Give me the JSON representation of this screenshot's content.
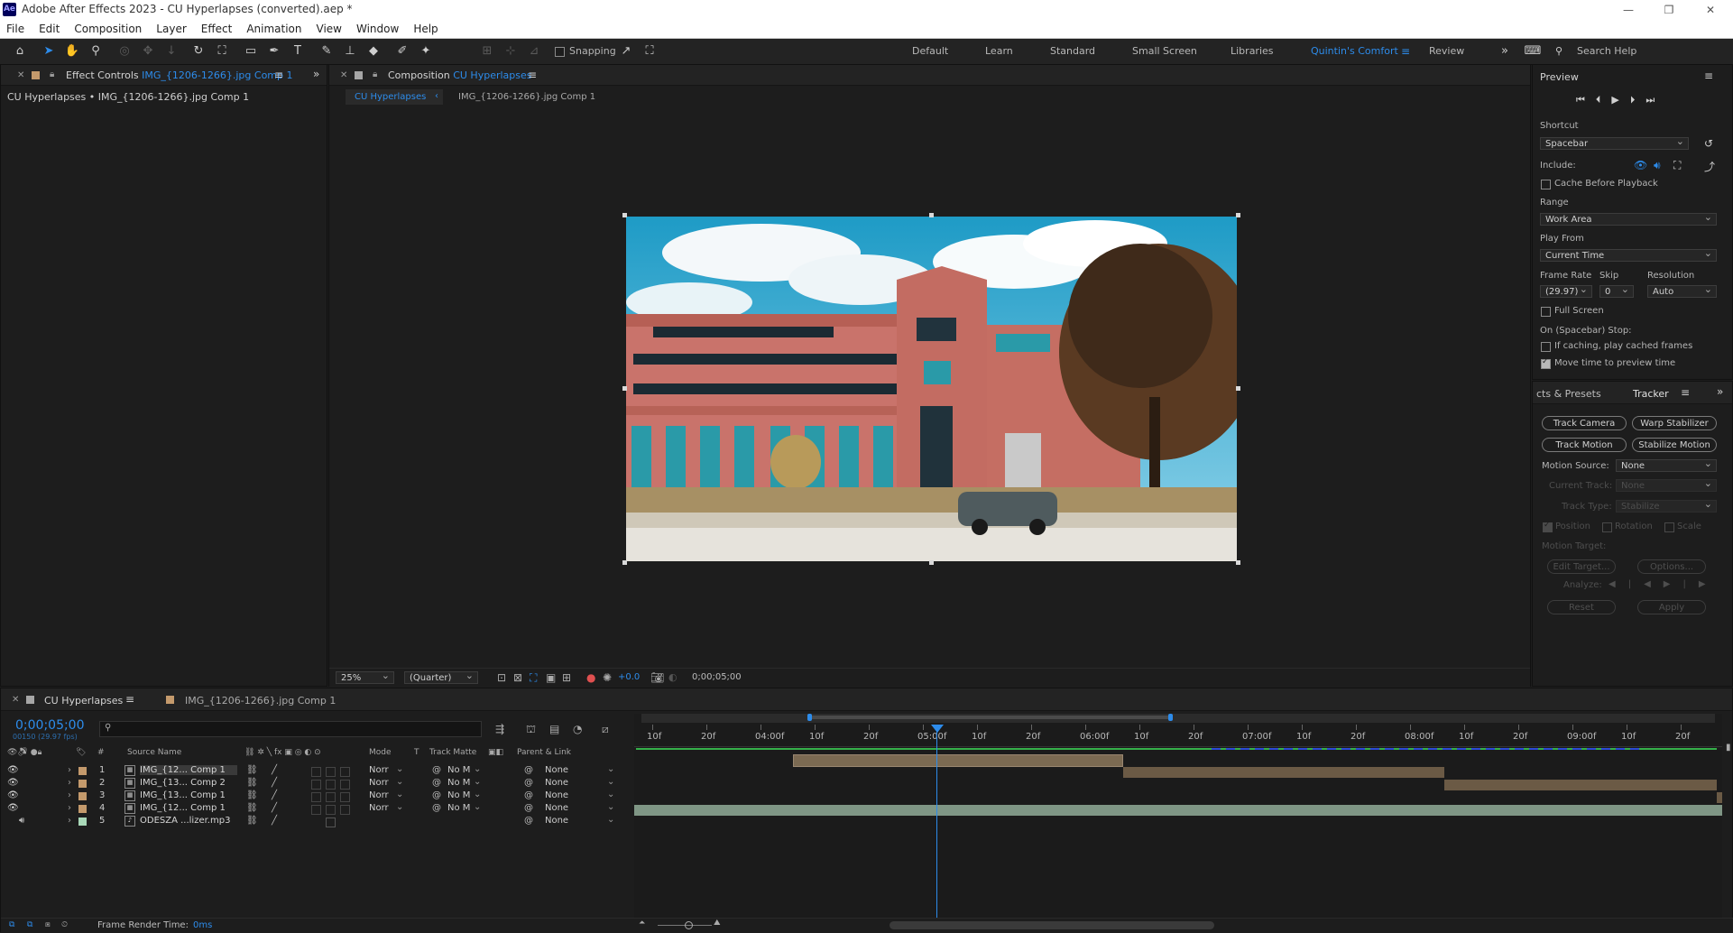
{
  "app": {
    "title": "Adobe After Effects 2023 - CU Hyperlapses (converted).aep *",
    "icon": "Ae",
    "window_controls": [
      "—",
      "❐",
      "✕"
    ]
  },
  "menu": [
    "File",
    "Edit",
    "Composition",
    "Layer",
    "Effect",
    "Animation",
    "View",
    "Window",
    "Help"
  ],
  "toolbar": {
    "snapping_label": "Snapping",
    "workspaces": [
      "Default",
      "Learn",
      "Standard",
      "Small Screen",
      "Libraries",
      "Quintin's Comfort",
      "Review"
    ],
    "active_workspace": "Quintin's Comfort",
    "search_placeholder": "Search Help"
  },
  "effect_controls": {
    "tab_prefix": "Effect Controls",
    "tab_target": "IMG_{1206-1266}.jpg Comp 1",
    "subheader": "CU Hyperlapses • IMG_{1206-1266}.jpg Comp 1"
  },
  "composition": {
    "tab_prefix": "Composition",
    "tab_target": "CU Hyperlapses",
    "flow_current": "CU Hyperlapses",
    "flow_next": "IMG_{1206-1266}.jpg Comp 1",
    "zoom": "25%",
    "resolution": "(Quarter)",
    "exposure": "+0.0",
    "timecode": "0;00;05;00"
  },
  "preview": {
    "title": "Preview",
    "shortcut_label": "Shortcut",
    "shortcut_value": "Spacebar",
    "include_label": "Include:",
    "cache_before_playback": "Cache Before Playback",
    "range_label": "Range",
    "range_value": "Work Area",
    "play_from_label": "Play From",
    "play_from_value": "Current Time",
    "frame_rate_label": "Frame Rate",
    "skip_label": "Skip",
    "resolution_label": "Resolution",
    "frame_rate_value": "(29.97)",
    "skip_value": "0",
    "resolution_value": "Auto",
    "full_screen": "Full Screen",
    "on_stop_label": "On (Spacebar) Stop:",
    "if_caching": "If caching, play cached frames",
    "move_time": "Move time to preview time"
  },
  "tracker": {
    "effects_tab": "cts & Presets",
    "tracker_tab": "Tracker",
    "track_camera": "Track Camera",
    "warp_stabilizer": "Warp Stabilizer",
    "track_motion": "Track Motion",
    "stabilize_motion": "Stabilize Motion",
    "motion_source_label": "Motion Source:",
    "motion_source_value": "None",
    "current_track_label": "Current Track:",
    "current_track_value": "None",
    "track_type_label": "Track Type:",
    "track_type_value": "Stabilize",
    "position": "Position",
    "rotation": "Rotation",
    "scale": "Scale",
    "motion_target_label": "Motion Target:",
    "edit_target": "Edit Target...",
    "options": "Options...",
    "analyze_label": "Analyze:",
    "reset": "Reset",
    "apply": "Apply"
  },
  "timeline": {
    "tab_active": "CU Hyperlapses",
    "tab_other": "IMG_{1206-1266}.jpg Comp 1",
    "current_time": "0;00;05;00",
    "frame_info": "00150 (29.97 fps)",
    "col_num": "#",
    "col_source": "Source Name",
    "col_mode": "Mode",
    "col_t": "T",
    "col_trackmatte": "Track Matte",
    "col_parent": "Parent & Link",
    "ruler": [
      "10f",
      "20f",
      "04:00f",
      "10f",
      "20f",
      "05:00f",
      "10f",
      "20f",
      "06:00f",
      "10f",
      "20f",
      "07:00f",
      "10f",
      "20f",
      "08:00f",
      "10f",
      "20f",
      "09:00f",
      "10f",
      "20f"
    ],
    "layers": [
      {
        "num": "1",
        "name": "IMG_{12... Comp 1",
        "mode": "Norr",
        "matte": "No M",
        "parent": "None"
      },
      {
        "num": "2",
        "name": "IMG_{13... Comp 2",
        "mode": "Norr",
        "matte": "No M",
        "parent": "None"
      },
      {
        "num": "3",
        "name": "IMG_{13... Comp 1",
        "mode": "Norr",
        "matte": "No M",
        "parent": "None"
      },
      {
        "num": "4",
        "name": "IMG_{12... Comp 1",
        "mode": "Norr",
        "matte": "No M",
        "parent": "None"
      },
      {
        "num": "5",
        "name": "ODESZA ...lizer.mp3",
        "mode": "",
        "matte": "",
        "parent": "None"
      }
    ],
    "frame_render_label": "Frame Render Time:",
    "frame_render_value": "0ms"
  },
  "colors": {
    "accent": "#2d8ceb",
    "layer_label": "#c49a6c",
    "audio_label": "#a9d8b8",
    "video_bar": "#6b5a45",
    "audio_bar": "#7f9685"
  }
}
